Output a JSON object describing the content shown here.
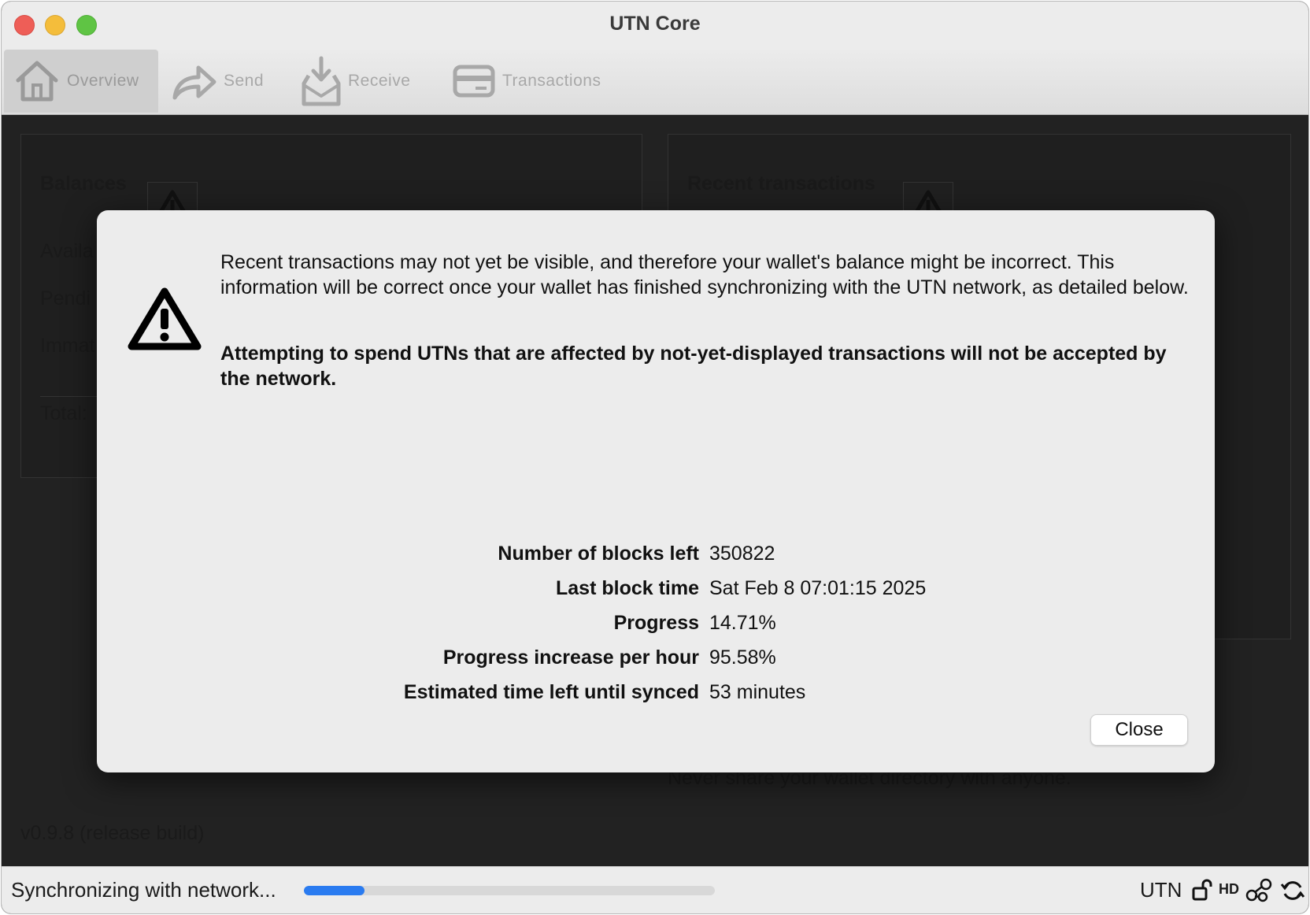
{
  "window": {
    "title": "UTN Core"
  },
  "toolbar": {
    "tabs": [
      {
        "label": "Overview",
        "icon": "home-icon",
        "active": true
      },
      {
        "label": "Send",
        "icon": "send-arrow-icon",
        "active": false
      },
      {
        "label": "Receive",
        "icon": "receive-inbox-icon",
        "active": false
      },
      {
        "label": "Transactions",
        "icon": "card-icon",
        "active": false
      }
    ]
  },
  "overview": {
    "balances_title": "Balances",
    "recent_title": "Recent transactions",
    "available_label": "Availa",
    "pending_label": "Pendi",
    "immature_label": "Immat",
    "total_label": "Total:",
    "version": "v0.9.8 (release build)",
    "footer_warning": "Never share your wallet directory with anyone."
  },
  "dialog": {
    "message": "Recent transactions may not yet be visible, and therefore your wallet's balance might be incorrect. This information will be correct once your wallet has finished synchronizing with the UTN network, as detailed below.",
    "bold_message": "Attempting to spend UTNs that are affected by not-yet-displayed transactions will not be accepted by the network.",
    "info": [
      {
        "label": "Number of blocks left",
        "value": "350822"
      },
      {
        "label": "Last block time",
        "value": "Sat Feb 8 07:01:15 2025"
      },
      {
        "label": "Progress",
        "value": "14.71%"
      },
      {
        "label": "Progress increase per hour",
        "value": "95.58%"
      },
      {
        "label": "Estimated time left until synced",
        "value": "53 minutes"
      }
    ],
    "close_label": "Close"
  },
  "statusbar": {
    "sync_text": "Synchronizing with network...",
    "progress_fraction": 0.147,
    "unit": "UTN",
    "hd_label": "HD",
    "icons": [
      "unlock-icon",
      "hd-icon",
      "network-icon",
      "sync-icon"
    ]
  },
  "colors": {
    "accent": "#2a7bf0",
    "window_bg": "#222222",
    "dialog_bg": "#ececec"
  }
}
